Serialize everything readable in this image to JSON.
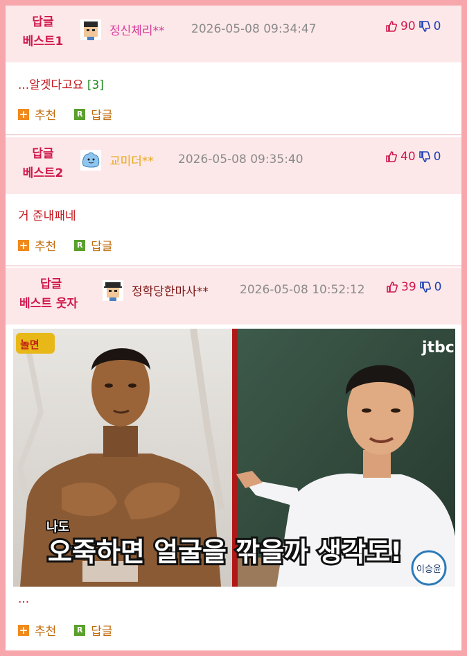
{
  "comments": [
    {
      "badge_line1": "답글",
      "badge_line2": "베스트1",
      "nickname": "정신체리**",
      "nick_color": "#d63a9a",
      "date": "2026-05-08 09:34:47",
      "up": "90",
      "down": "0",
      "text": "...알겟다고요",
      "reply_count": "[3]",
      "recommend_label": "추천",
      "reply_label": "답글"
    },
    {
      "badge_line1": "답글",
      "badge_line2": "베스트2",
      "nickname": "교미더**",
      "nick_color": "#e8a81c",
      "date": "2026-05-08 09:35:40",
      "up": "40",
      "down": "0",
      "text": "거 쥰내패네",
      "recommend_label": "추천",
      "reply_label": "답글"
    },
    {
      "badge_line1": "답글",
      "badge_line2": "베스트 웃자",
      "nickname": "정학당한마사**",
      "nick_color": "#7a1414",
      "date": "2026-05-08 10:52:12",
      "up": "39",
      "down": "0",
      "image": {
        "left_caption_small": "나도",
        "caption": "오죽하면 얼굴을 깎을까 생각도!",
        "logo_right": "jtbc",
        "name_badge": "이승윤"
      },
      "text": "...",
      "recommend_label": "추천",
      "reply_label": "답글"
    }
  ],
  "colors": {
    "frame": "#f7a7ab",
    "header_bg": "#fde8e9",
    "badge": "#d0184c",
    "upvote": "#d0184c",
    "downvote": "#1f3fb5"
  }
}
